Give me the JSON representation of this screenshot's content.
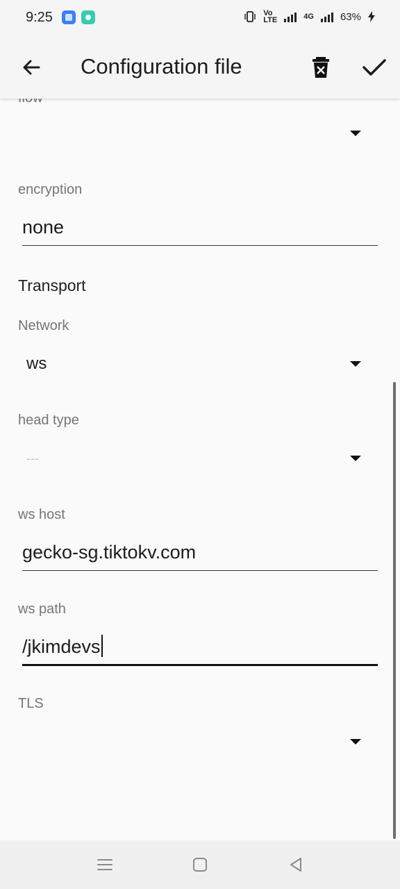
{
  "status_bar": {
    "time": "9:25",
    "volte": "Vo LTE",
    "network": "4G",
    "battery": "63%",
    "icons": [
      "vibrate-icon",
      "volte-icon",
      "signal-icon",
      "4g-signal-icon",
      "battery-charging-icon"
    ]
  },
  "app_bar": {
    "title": "Configuration file",
    "back_icon": "arrow-back-icon",
    "delete_icon": "delete-icon",
    "confirm_icon": "check-icon"
  },
  "form": {
    "flow": {
      "label": "flow",
      "value": ""
    },
    "encryption": {
      "label": "encryption",
      "value": "none"
    },
    "transport_title": "Transport",
    "network": {
      "label": "Network",
      "value": "ws"
    },
    "head_type": {
      "label": "head type",
      "value": "---"
    },
    "ws_host": {
      "label": "ws host",
      "value": "gecko-sg.tiktokv.com"
    },
    "ws_path": {
      "label": "ws path",
      "value": "/jkimdevs"
    },
    "tls": {
      "label": "TLS",
      "value": ""
    }
  },
  "nav_bar": {
    "icons": [
      "menu-icon",
      "home-icon",
      "back-icon"
    ]
  },
  "colors": {
    "background": "#fafafa",
    "app_bar": "#f5f5f5",
    "label_gray": "#757575",
    "text": "#1c1c1c"
  }
}
